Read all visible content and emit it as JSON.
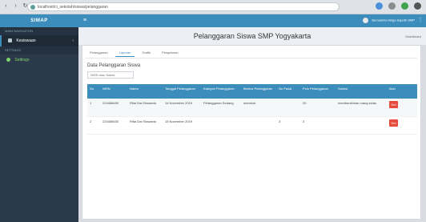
{
  "browser": {
    "url": "localhost/ci_sekolah/siswa/pelanggaran",
    "colors": {
      "accent": "#3c8dbc",
      "danger": "#e64c3c"
    }
  },
  "sidebar": {
    "brand": "SIMAP",
    "header_main": "MAIN NAVIGATION",
    "item_dashboard": "Kesiswaan",
    "header_settings": "SETTINGS",
    "item_settings": "Settings"
  },
  "topbar": {
    "toggle_icon": "hamburger-icon",
    "user_name": "Bernadeta Helga Saputri SMP"
  },
  "header": {
    "title": "Pelanggaran Siswa SMP Yogyakarta",
    "crumb": "Dashboard"
  },
  "tabs": [
    "Pelanggaran",
    "Laporan",
    "Grafik",
    "Pengaturan"
  ],
  "section_title": "Data Pelanggaran Siswa",
  "search": {
    "placeholder": "NISN atau Nama"
  },
  "table": {
    "headers": [
      "No",
      "NISN",
      "Nama",
      "Tanggal Pelanggaran",
      "Kategori Pelanggaran",
      "Bentuk Pelanggaran",
      "No Pasal",
      "Poin Pelanggaran",
      "Sanksi",
      "Aksi"
    ],
    "rows": [
      {
        "no": "1",
        "nisn": "223456630",
        "nama": "Rifai Dwi Siswanto",
        "tanggal": "14 November 2019",
        "kategori": "Pelanggaran Sedang",
        "bentuk": "merokok",
        "pasal": "",
        "poin": "20",
        "sanksi": "membersihkan ruang kelas",
        "aksi": "Del"
      },
      {
        "no": "2",
        "nisn": "223456630",
        "nama": "Rifai Dwi Siswanto",
        "tanggal": "15 November 2019",
        "kategori": "",
        "bentuk": "",
        "pasal": "3",
        "poin": "3",
        "sanksi": "",
        "aksi": "Del"
      }
    ]
  }
}
